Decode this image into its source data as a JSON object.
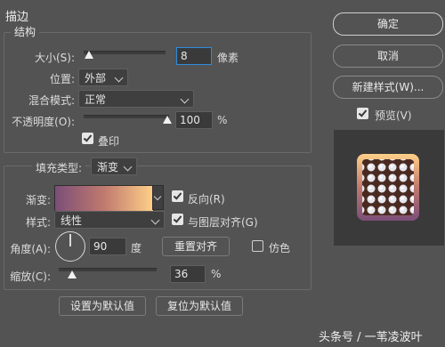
{
  "section_title": "描边",
  "structure": {
    "title": "结构",
    "size_label": "大小(S):",
    "size_value": "8",
    "size_unit": "像素",
    "position_label": "位置:",
    "position_value": "外部",
    "blend_label": "混合模式:",
    "blend_value": "正常",
    "opacity_label": "不透明度(O):",
    "opacity_value": "100",
    "opacity_unit": "%",
    "overprint_label": "叠印",
    "overprint_checked": true
  },
  "fill": {
    "type_label": "填充类型:",
    "type_value": "渐变",
    "gradient_label": "渐变:",
    "reverse_label": "反向(R)",
    "reverse_checked": true,
    "style_label": "样式:",
    "style_value": "线性",
    "align_label": "与图层对齐(G)",
    "align_checked": true,
    "angle_label": "角度(A):",
    "angle_value": "90",
    "angle_unit": "度",
    "reset_align_label": "重置对齐",
    "dither_label": "仿色",
    "dither_checked": false,
    "scale_label": "缩放(C):",
    "scale_value": "36",
    "scale_unit": "%"
  },
  "defaults": {
    "set_default_label": "设置为默认值",
    "reset_default_label": "复位为默认值"
  },
  "side": {
    "ok_label": "确定",
    "cancel_label": "取消",
    "new_style_label": "新建样式(W)...",
    "preview_label": "预览(V)",
    "preview_checked": true
  },
  "watermark": "头条号 / 一苇凌波叶",
  "colors": {
    "gradient_start": "#7b4e78",
    "gradient_mid": "#c07a6e",
    "gradient_end": "#ffd088"
  }
}
